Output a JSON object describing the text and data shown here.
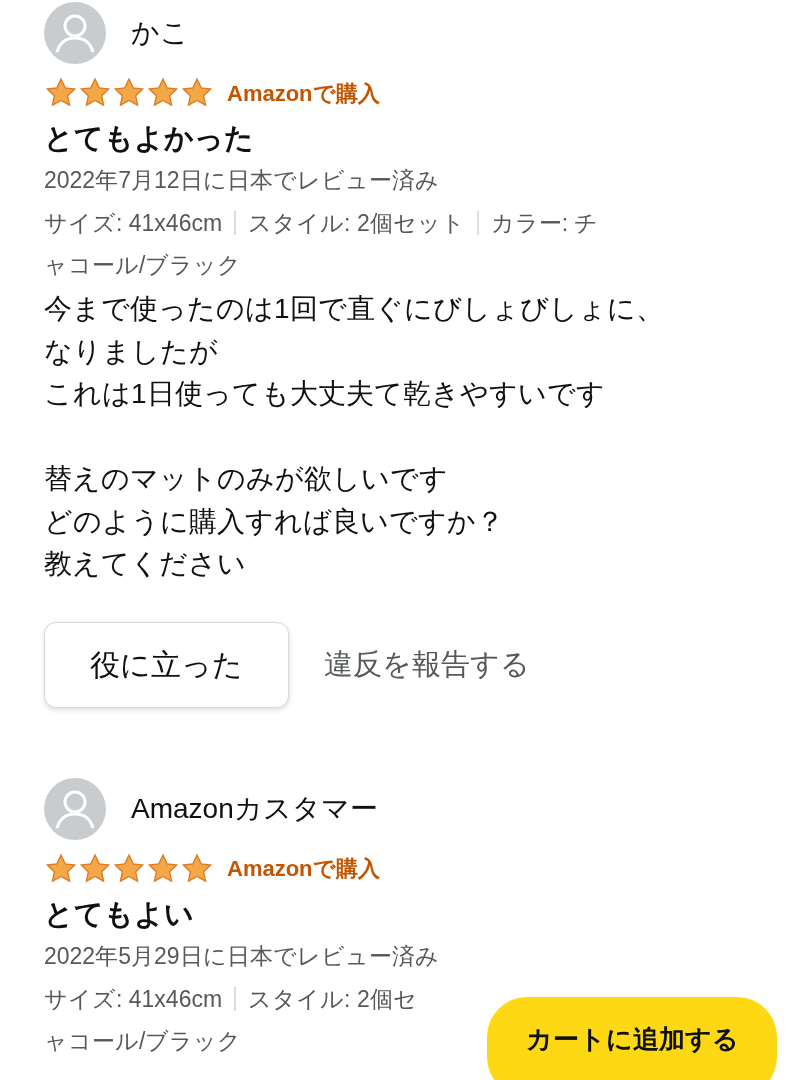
{
  "reviews": [
    {
      "author": "かこ",
      "stars": 5,
      "badge": "Amazonで購入",
      "title": "とてもよかった",
      "date": "2022年7月12日に日本でレビュー済み",
      "meta_lines": [
        [
          "サイズ: 41x46cm",
          "スタイル: 2個セット",
          "カラー: チ"
        ],
        [
          "ャコール/ブラック"
        ]
      ],
      "body": [
        [
          "今まで使ったのは1回で直ぐにびしょびしょに、",
          "なりましたが",
          "これは1日使っても大丈夫て乾きやすいです"
        ],
        [
          "替えのマットのみが欲しいです",
          "どのように購入すれば良いですか？",
          "教えてください"
        ]
      ],
      "helpful_button": "役に立った",
      "report_link": "違反を報告する"
    },
    {
      "author": "Amazonカスタマー",
      "stars": 5,
      "badge": "Amazonで購入",
      "title": "とてもよい",
      "date": "2022年5月29日に日本でレビュー済み",
      "meta_lines": [
        [
          "サイズ: 41x46cm",
          "スタイル: 2個セ"
        ],
        [
          "ャコール/ブラック"
        ]
      ]
    }
  ],
  "cart_button": "カートに追加する"
}
